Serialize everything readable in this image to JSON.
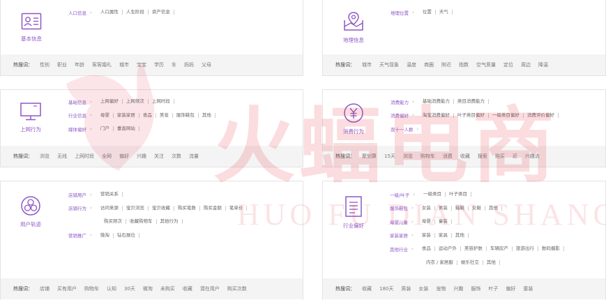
{
  "cards": [
    {
      "id": "basic",
      "icon": "id-card-icon",
      "title": "基本信息",
      "rows": [
        {
          "cat": "人口信息",
          "items": [
            "人口属性",
            "人生阶段",
            "资产信息"
          ]
        }
      ],
      "keywords_label": "热搜词：",
      "keywords": [
        "性别",
        "职业",
        "年龄",
        "客客婚礼",
        "城市",
        "宝宝",
        "学历",
        "车",
        "妈妈",
        "父母"
      ]
    },
    {
      "id": "geo",
      "icon": "map-pin-icon",
      "title": "地理信息",
      "rows": [
        {
          "cat": "地理位置",
          "items": [
            "位置",
            "天气"
          ]
        }
      ],
      "keywords_label": "热搜词：",
      "keywords": [
        "城市",
        "天气现象",
        "温度",
        "商圈",
        "附近",
        "指数",
        "空气质量",
        "定位",
        "周边",
        "降温"
      ]
    },
    {
      "id": "online",
      "icon": "monitor-icon",
      "title": "上网行为",
      "rows": [
        {
          "cat": "基础信息",
          "items": [
            "上网偏好",
            "上网频次",
            "上网时段"
          ]
        },
        {
          "cat": "行业信息",
          "items": [
            "母婴",
            "家装家居",
            "食品",
            "美妆",
            "服饰鞋包",
            "其他"
          ]
        },
        {
          "cat": "媒体偏好",
          "items": [
            "门户",
            "垂直网站"
          ]
        }
      ],
      "keywords_label": "热搜词：",
      "keywords": [
        "浏览",
        "无线",
        "上网时段",
        "全网",
        "偏好",
        "兴趣",
        "关注",
        "次数",
        "流量"
      ]
    },
    {
      "id": "consume",
      "icon": "yen-icon",
      "title": "消费行为",
      "rows": [
        {
          "cat": "消费能力",
          "items": [
            "基础消费能力",
            "类目消费能力"
          ]
        },
        {
          "cat": "消费偏好",
          "items": [
            "淘宝消费偏好",
            "叶子类目偏好",
            "一级类目偏好",
            "消费评价偏好"
          ]
        },
        {
          "cat": "双十一人群",
          "items": []
        }
      ],
      "keywords_label": "热搜词：",
      "keywords": [
        "聚划算",
        "15天",
        "浏览",
        "购物车",
        "消费",
        "收藏",
        "搜索",
        "购买",
        "近",
        "兴趣点"
      ]
    },
    {
      "id": "track",
      "icon": "network-icon",
      "title": "用户轨迹",
      "rows": [
        {
          "cat": "店铺用户",
          "items": [
            "营销关系"
          ]
        },
        {
          "cat": "店铺行为",
          "items": [
            "访问来源",
            "宝贝浏览",
            "宝贝收藏",
            "购买笔数",
            "购买金额",
            "笔单价"
          ]
        },
        {
          "cat": "",
          "items": [
            "购买频次",
            "收藏购物车",
            "其他行为"
          ]
        },
        {
          "cat": "营销推广",
          "items": [
            "微淘",
            "钻石展位"
          ]
        }
      ],
      "keywords_label": "热搜词：",
      "keywords": [
        "店铺",
        "买有用户",
        "购物车",
        "认知",
        "30天",
        "微淘",
        "未购买",
        "收藏",
        "潜在用户",
        "购买次数"
      ]
    },
    {
      "id": "industry",
      "icon": "document-icon",
      "title": "行业偏好",
      "rows": [
        {
          "cat": "一级/叶子",
          "items": [
            "一级类目",
            "叶子类目"
          ]
        },
        {
          "cat": "服饰鞋包",
          "items": [
            "女装",
            "男装",
            "箱鞋",
            "女鞋",
            "其他"
          ]
        },
        {
          "cat": "母婴儿童",
          "items": [
            "母婴",
            "童装"
          ]
        },
        {
          "cat": "家装家居",
          "items": [
            "家装",
            "家具",
            "其他"
          ]
        },
        {
          "cat": "其他行业",
          "items": [
            "食品",
            "运动户外",
            "美容护肤",
            "车辆房产",
            "旅游出行",
            "数码摄影"
          ]
        },
        {
          "cat": "",
          "items": [
            "内衣 / 家居服",
            "娱乐社交",
            "其他"
          ]
        }
      ],
      "keywords_label": "热搜词：",
      "keywords": [
        "收藏",
        "180天",
        "男装",
        "女装",
        "宠物",
        "兴趣",
        "服饰",
        "叶子",
        "偏好",
        "童装"
      ]
    }
  ],
  "watermark": {
    "cn": "火蝠电商",
    "en": "HUO FU DIAN SHANG"
  },
  "colors": {
    "accent": "#8e57c6",
    "watermark": "#e8354a"
  }
}
